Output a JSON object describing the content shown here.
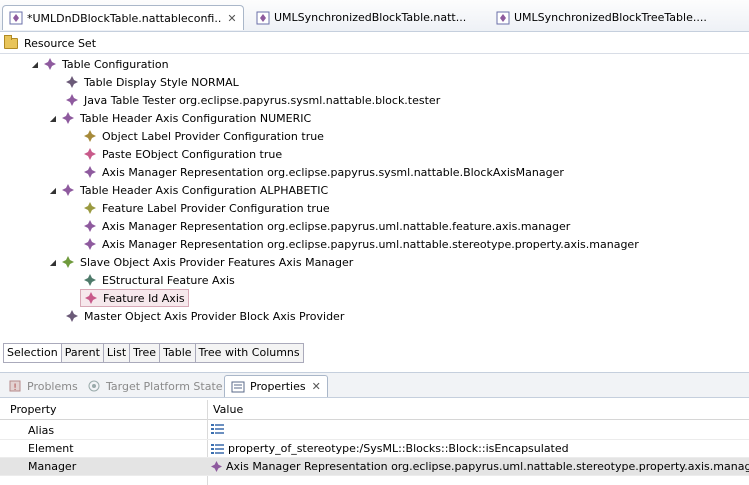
{
  "editor_tabs": [
    {
      "label": "*UMLDnDBlockTable.nattableconfi...",
      "close": "✕"
    },
    {
      "label": "UMLSynchronizedBlockTable.natt..."
    },
    {
      "label": "UMLSynchronizedBlockTreeTable...."
    }
  ],
  "resource_set": "Resource Set",
  "tree": [
    {
      "text": "Table Configuration"
    },
    {
      "text": "Table Display Style NORMAL"
    },
    {
      "text": "Java Table Tester org.eclipse.papyrus.sysml.nattable.block.tester"
    },
    {
      "text": "Table Header Axis Configuration NUMERIC"
    },
    {
      "text": "Object Label Provider Configuration true"
    },
    {
      "text": "Paste EObject Configuration true"
    },
    {
      "text": "Axis Manager Representation org.eclipse.papyrus.sysml.nattable.BlockAxisManager"
    },
    {
      "text": "Table Header Axis Configuration ALPHABETIC"
    },
    {
      "text": "Feature Label Provider Configuration true"
    },
    {
      "text": "Axis Manager Representation org.eclipse.papyrus.uml.nattable.feature.axis.manager"
    },
    {
      "text": "Axis Manager Representation org.eclipse.papyrus.uml.nattable.stereotype.property.axis.manager"
    },
    {
      "text": "Slave Object Axis Provider Features Axis Manager"
    },
    {
      "text": "EStructural Feature Axis"
    },
    {
      "text": "Feature Id Axis"
    },
    {
      "text": "Master Object Axis Provider Block Axis Provider"
    }
  ],
  "view_tabs": [
    "Selection",
    "Parent",
    "List",
    "Tree",
    "Table",
    "Tree with Columns"
  ],
  "bottom_tabs": {
    "problems": "Problems",
    "target": "Target Platform State",
    "properties": "Properties",
    "close": "✕"
  },
  "properties": {
    "col_property": "Property",
    "col_value": "Value",
    "rows": [
      {
        "name": "Alias",
        "value": ""
      },
      {
        "name": "Element",
        "value": "property_of_stereotype:/SysML::Blocks::Block::isEncapsulated"
      },
      {
        "name": "Manager",
        "value": "Axis Manager Representation org.eclipse.papyrus.uml.nattable.stereotype.property.axis.manager"
      }
    ]
  },
  "colors": {
    "diamond_purple": "#8e5a9e",
    "diamond_green": "#6f9a3c",
    "diamond_pink": "#c85a8a"
  }
}
